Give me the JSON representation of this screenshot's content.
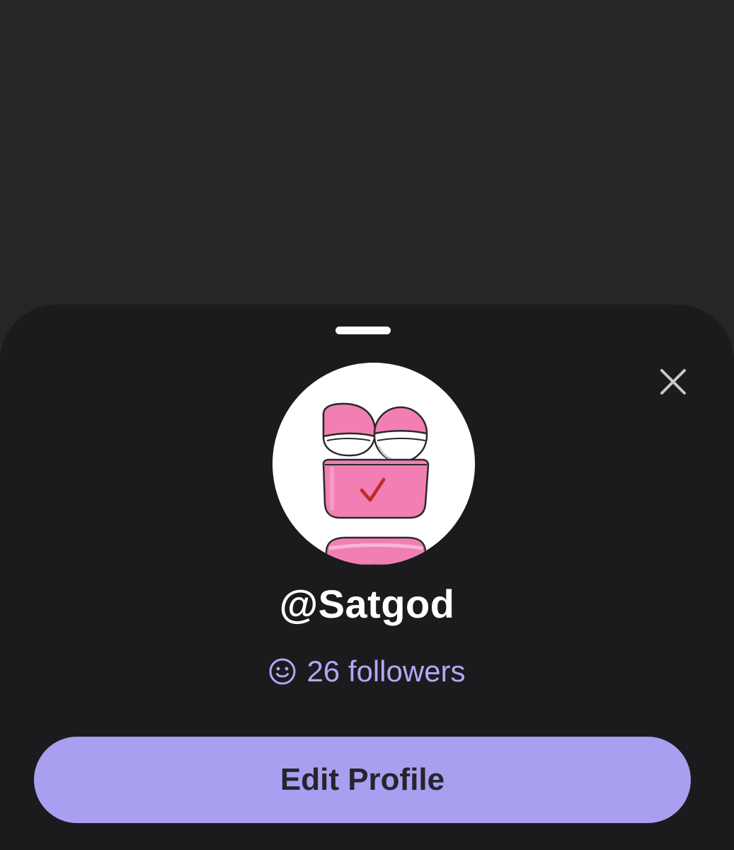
{
  "profile": {
    "username": "@Satgod",
    "followers_label": "26 followers",
    "avatar_icon": "pink-cartoon-character-avatar",
    "edit_button_label": "Edit Profile"
  },
  "icons": {
    "close": "close-icon",
    "followers": "smiley-face-icon"
  },
  "colors": {
    "sheet_background": "#1b1b1d",
    "backdrop": "#262629",
    "accent": "#a99ff0",
    "followers_text": "#b4a7f5",
    "avatar_pink": "#f27fb3"
  }
}
